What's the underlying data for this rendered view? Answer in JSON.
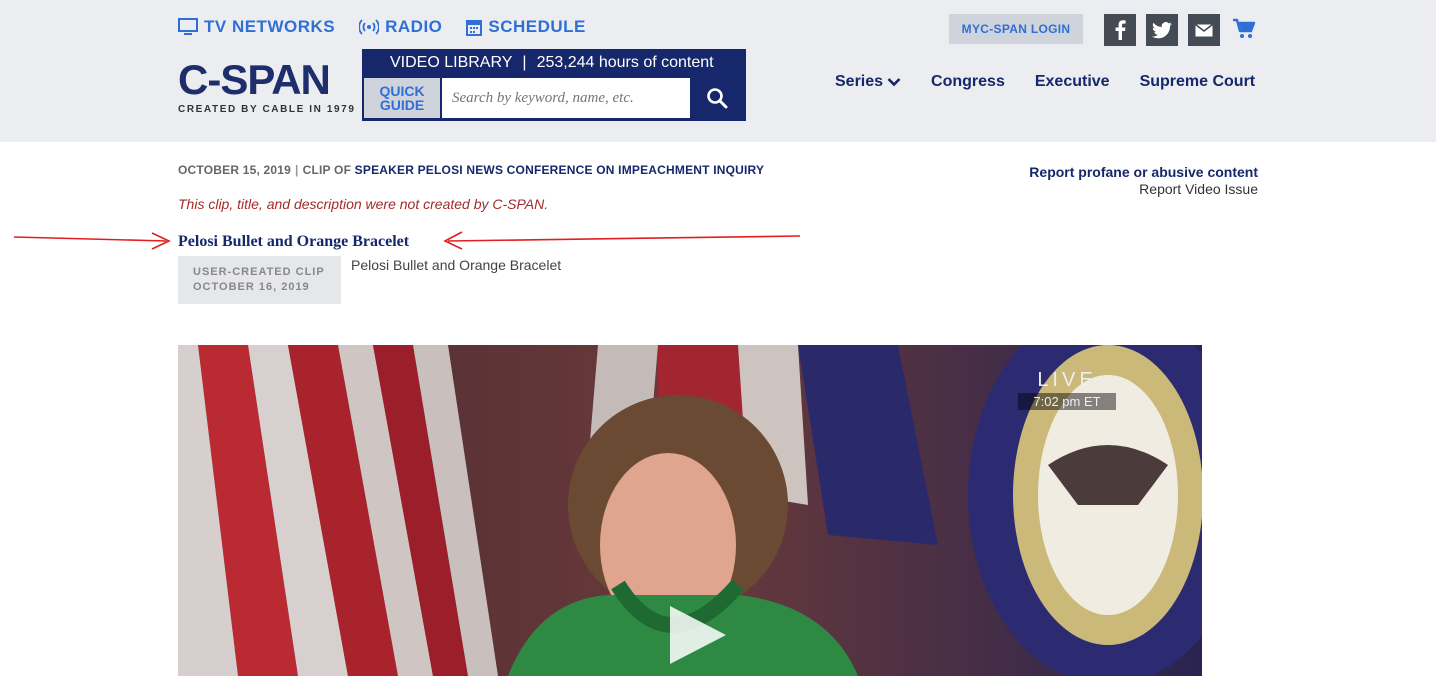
{
  "topnav": [
    {
      "label": "TV NETWORKS",
      "icon": "tv-icon"
    },
    {
      "label": "RADIO",
      "icon": "radio-icon"
    },
    {
      "label": "SCHEDULE",
      "icon": "calendar-icon"
    }
  ],
  "logo": {
    "name": "C-SPAN",
    "tagline": "CREATED BY CABLE IN 1979"
  },
  "video_library": {
    "title": "VIDEO LIBRARY",
    "hours": "253,244 hours of content",
    "quick_guide_line1": "QUICK",
    "quick_guide_line2": "GUIDE",
    "search_placeholder": "Search by keyword, name, etc."
  },
  "account": {
    "login": "MYC-SPAN LOGIN"
  },
  "social": [
    "facebook-icon",
    "twitter-icon",
    "email-icon",
    "cart-icon"
  ],
  "mainnav": [
    {
      "label": "Series"
    },
    {
      "label": "Congress"
    },
    {
      "label": "Executive"
    },
    {
      "label": "Supreme Court"
    }
  ],
  "clip": {
    "date": "OCTOBER 15, 2019",
    "sep": "|",
    "clip_of_prefix": "CLIP OF",
    "program": "SPEAKER PELOSI NEWS CONFERENCE ON IMPEACHMENT INQUIRY",
    "disclaimer": "This clip, title, and description were not created by C-SPAN.",
    "title": "Pelosi Bullet and Orange Bracelet",
    "badge_line1": "USER-CREATED CLIP",
    "badge_line2": "OCTOBER 16, 2019",
    "description": "Pelosi Bullet and Orange Bracelet"
  },
  "report": {
    "profane": "Report profane or abusive content",
    "video_issue": "Report Video Issue"
  },
  "player": {
    "live": "LIVE",
    "time": "7:02 pm ET"
  },
  "colors": {
    "navy": "#16286b",
    "link_blue": "#2f6fd6",
    "header_bg": "#ebedf0",
    "annotation_red": "#e02020"
  }
}
